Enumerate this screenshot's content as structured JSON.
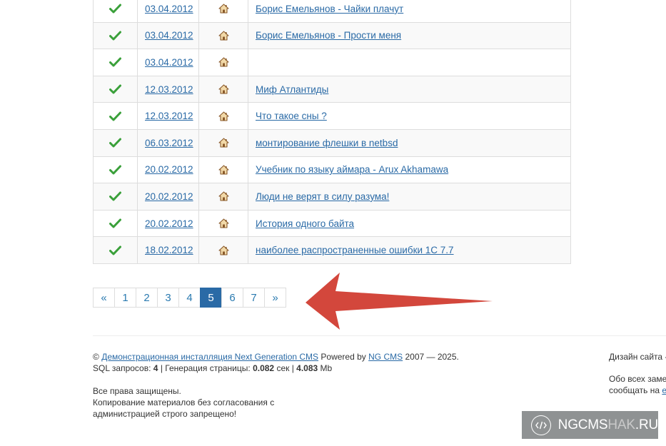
{
  "rows": [
    {
      "date": "03.04.2012",
      "title": "Борис Емельянов - Чайки плачут"
    },
    {
      "date": "03.04.2012",
      "title": "Борис Емельянов - Прости меня"
    },
    {
      "date": "03.04.2012",
      "title": ""
    },
    {
      "date": "12.03.2012",
      "title": "Миф Атлантиды"
    },
    {
      "date": "12.03.2012",
      "title": "Что такое сны ?"
    },
    {
      "date": "06.03.2012",
      "title": "монтирование флешки в netbsd"
    },
    {
      "date": "20.02.2012",
      "title": "Учебник по языку аймара - Arux Akhamawa"
    },
    {
      "date": "20.02.2012",
      "title": "Люди не верят в силу разума!"
    },
    {
      "date": "20.02.2012",
      "title": "История одного байта"
    },
    {
      "date": "18.02.2012",
      "title": "наиболее распространенные ошибки 1С 7.7"
    }
  ],
  "icons": {
    "status": "check-icon",
    "home": "house-icon"
  },
  "pagination": {
    "prev": "«",
    "pages": [
      "1",
      "2",
      "3",
      "4",
      "5",
      "6",
      "7"
    ],
    "current": "5",
    "next": "»"
  },
  "footer": {
    "copyright": "©",
    "site_link": "Демонстрационная инсталляция Next Generation CMS",
    "powered_by": "Powered by",
    "cms_link": "NG CMS",
    "years": "2007 — 2025.",
    "sql_label": "SQL запросов:",
    "sql_count": "4",
    "gen_label": "| Генерация страницы:",
    "gen_time": "0.082",
    "gen_unit": "сек |",
    "memory": "4.083",
    "memory_unit": "Mb",
    "rights_1": "Все права защищены.",
    "rights_2": "Копирование материалов без согласования с",
    "rights_3": "администрацией строго запрещено!",
    "design": "Дизайн сайта -",
    "notice_1": "Обо всех заме",
    "notice_2": "сообщать на",
    "notice_link": "е"
  },
  "watermark": {
    "text_a": "NGCMS",
    "text_b": "HAK",
    "text_c": ".RU",
    "icon": "code-icon"
  },
  "colors": {
    "accent": "#2a6aa6",
    "check": "#3aa03a",
    "arrow": "#d3473c"
  }
}
